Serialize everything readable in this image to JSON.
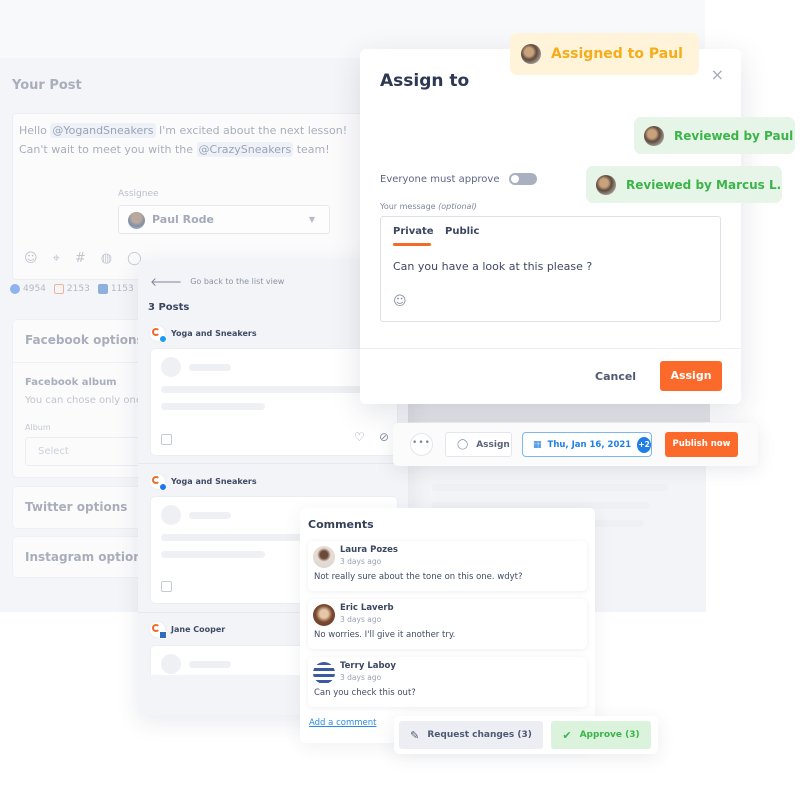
{
  "background_post": {
    "title": "Your Post",
    "text_line1_pre": "Hello ",
    "mention1": "@YogandSneakers",
    "text_line1_post": " I'm excited about the next lesson!",
    "text_line2_pre": "Can't wait to meet you with the ",
    "mention2": "@CrazySneakers",
    "text_line2_post": " team!",
    "assignee_label": "Assignee",
    "assignee_value": "Paul Rode",
    "tools": [
      "☺",
      "⌖",
      "#",
      "◍",
      "◯"
    ],
    "stats": [
      {
        "network": "facebook",
        "count": "4954",
        "color": "#8fb4ec"
      },
      {
        "network": "instagram",
        "count": "2153",
        "color": "#f3b39a"
      },
      {
        "network": "linkedin",
        "count": "1153",
        "color": "#8fb0df"
      }
    ],
    "facebook_options": {
      "title": "Facebook options",
      "album_title": "Facebook album",
      "album_desc": "You can chose only one",
      "album_label": "Album",
      "album_placeholder": "Select"
    },
    "twitter_options": {
      "title": "Twitter options"
    },
    "instagram_options": {
      "title": "Instagram options"
    }
  },
  "post_list": {
    "back_label": "Go back to the list view",
    "count_label": "3 Posts",
    "posts": [
      {
        "account": "Yoga and Sneakers",
        "network": "twitter",
        "badge_color": "#1d9bf0"
      },
      {
        "account": "Yoga and Sneakers",
        "network": "facebook",
        "badge_color": "#1877f2"
      },
      {
        "account": "Jane Cooper",
        "network": "linkedin",
        "badge_color": "#2f6fb8"
      }
    ]
  },
  "assign_modal": {
    "title": "Assign to",
    "close_icon": "×",
    "everyone_must_approve_label": "Everyone must approve",
    "everyone_must_approve": false,
    "message_label": "Your message ",
    "message_label_optional": "(optional)",
    "tabs": [
      {
        "label": "Private",
        "active": true
      },
      {
        "label": "Public",
        "active": false
      }
    ],
    "message": "Can you have a look at this please ?",
    "cancel_label": "Cancel",
    "assign_label": "Assign"
  },
  "badges": {
    "assigned": "Assigned to Paul",
    "reviewed_paul": "Reviewed by Paul",
    "reviewed_marcus": "Reviewed by Marcus L."
  },
  "action_bar": {
    "more_label": "•••",
    "assign_label": "Assign",
    "date_label": "Thu, Jan 16, 2021",
    "date_extra": "+2",
    "publish_label": "Publish now"
  },
  "comments": {
    "title": "Comments",
    "items": [
      {
        "name": "Laura Pozes",
        "time": "3 days ago",
        "text": "Not really sure about the tone on this one. wdyt?"
      },
      {
        "name": "Eric Laverb",
        "time": "3 days ago",
        "text": "No worries. I'll give it another try."
      },
      {
        "name": "Terry Laboy",
        "time": "3 days ago",
        "text": "Can you check this out?"
      }
    ],
    "add_label": "Add a comment"
  },
  "review_actions": {
    "request_changes_label": "Request changes (3)",
    "approve_label": "Approve (3)"
  },
  "colors": {
    "accent_orange": "#fb6a2b",
    "assigned_yellow": "#f5ad1b",
    "reviewed_green": "#3bb54a",
    "link_blue": "#2b8ae6"
  }
}
